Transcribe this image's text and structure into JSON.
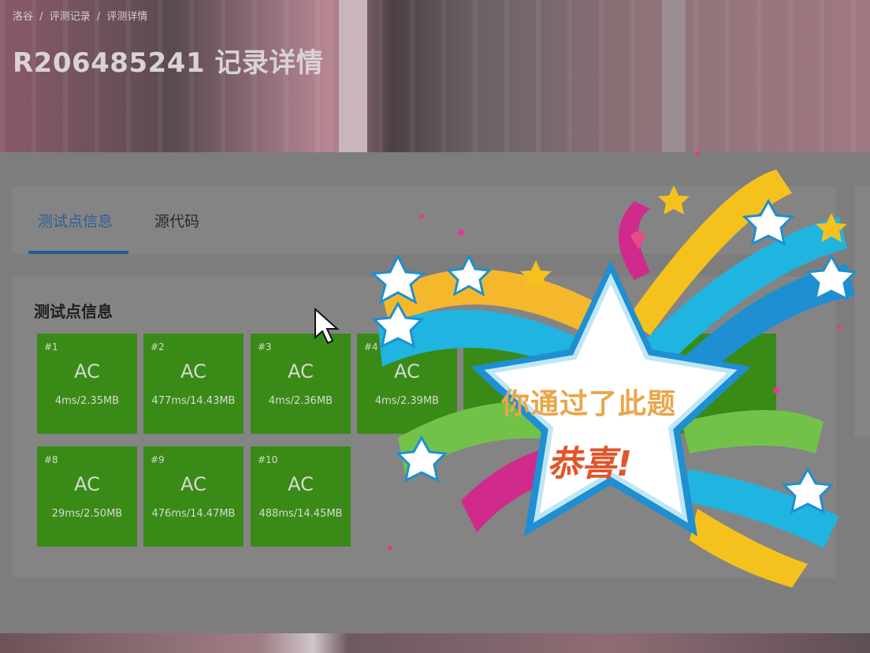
{
  "breadcrumb": [
    "洛谷",
    "/",
    "评测记录",
    "/",
    "评测详情"
  ],
  "page_title": "R206485241 记录详情",
  "tabs": [
    {
      "label": "测试点信息",
      "active": true
    },
    {
      "label": "源代码",
      "active": false
    }
  ],
  "section_title": "测试点信息",
  "tests": [
    {
      "index": "#1",
      "status": "AC",
      "usage": "4ms/2.35MB"
    },
    {
      "index": "#2",
      "status": "AC",
      "usage": "477ms/14.43MB"
    },
    {
      "index": "#3",
      "status": "AC",
      "usage": "4ms/2.36MB"
    },
    {
      "index": "#4",
      "status": "AC",
      "usage": "4ms/2.39MB"
    },
    {
      "index": "#8",
      "status": "AC",
      "usage": "29ms/2.50MB"
    },
    {
      "index": "#9",
      "status": "AC",
      "usage": "476ms/14.47MB"
    },
    {
      "index": "#10",
      "status": "AC",
      "usage": "488ms/14.45MB"
    }
  ],
  "celebration": {
    "line1": "你通过了此题",
    "line2": "恭喜!"
  },
  "colors": {
    "ac_green": "#3a8a18",
    "accent_blue": "#245b8f",
    "celebration_text": "#e9a64a",
    "celebration_emphasis": "#e2552a"
  }
}
